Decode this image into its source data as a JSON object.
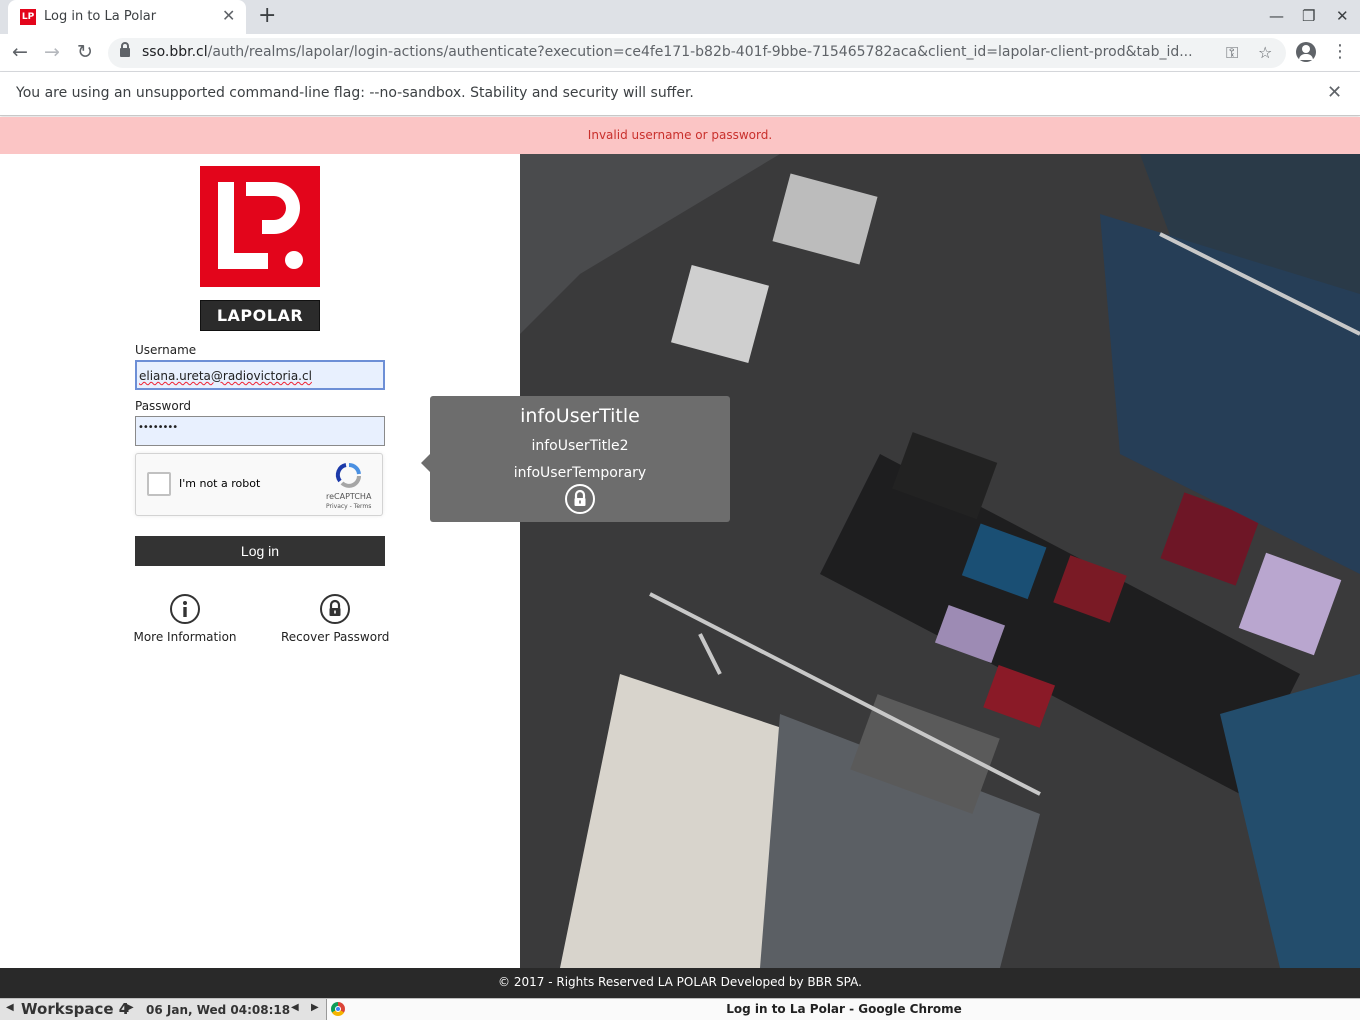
{
  "browser": {
    "tab_title": "Log in to La Polar",
    "tab_favicon_text": "LP",
    "url_host": "sso.bbr.cl",
    "url_path": "/auth/realms/lapolar/login-actions/authenticate?execution=ce4fe171-b82b-401f-9bbe-715465782aca&client_id=lapolar-client-prod&tab_id...",
    "infobar_text": "You are using an unsupported command-line flag: --no-sandbox. Stability and security will suffer.",
    "icons": [
      "back-icon",
      "forward-icon",
      "reload-icon",
      "lock-icon",
      "key-icon",
      "star-icon",
      "profile-icon",
      "menu-icon",
      "new-tab-icon",
      "minimize-icon",
      "restore-icon",
      "close-icon"
    ]
  },
  "page": {
    "error_message": "Invalid username or password.",
    "logo_wordmark": "LAPOLAR",
    "username_label": "Username",
    "username_value": "eliana.ureta@radiovictoria.cl",
    "password_label": "Password",
    "password_value": "••••••••",
    "captcha_label": "I'm not a robot",
    "captcha_brand": "reCAPTCHA",
    "captcha_links": "Privacy - Terms",
    "login_button": "Log in",
    "more_info_label": "More Information",
    "recover_password_label": "Recover Password",
    "footer_text": "© 2017 - Rights Reserved LA POLAR Developed by BBR SPA.",
    "popover": {
      "title": "infoUserTitle",
      "subtitle": "infoUserTitle2",
      "temporary": "infoUserTemporary"
    },
    "colors": {
      "brand_red": "#e3051b",
      "error_bg": "#fbc5c5",
      "error_text": "#c9302c",
      "button_dark": "#333333",
      "popover_bg": "#6d6d6d"
    }
  },
  "taskbar": {
    "workspace": "Workspace 4",
    "datetime": "06 Jan, Wed 04:08:18",
    "window_title": "Log in to La Polar - Google Chrome"
  }
}
